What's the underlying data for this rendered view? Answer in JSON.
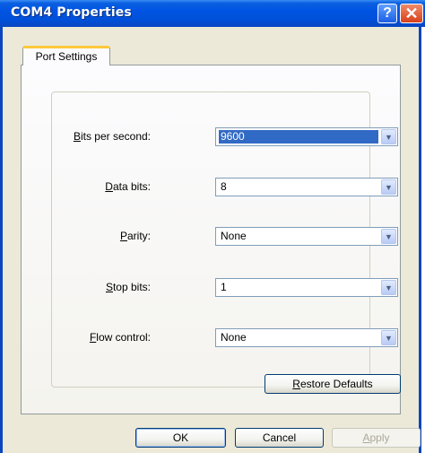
{
  "window": {
    "title": "COM4 Properties",
    "help_glyph": "?",
    "close_glyph": "✕"
  },
  "tabs": [
    {
      "label": "Port Settings",
      "active": true
    }
  ],
  "settings": {
    "bits_per_second": {
      "label_mnemonic": "B",
      "label_rest": "its per second:",
      "value": "9600"
    },
    "data_bits": {
      "label_mnemonic": "D",
      "label_rest": "ata bits:",
      "value": "8"
    },
    "parity": {
      "label_pre": "",
      "label_mnemonic": "P",
      "label_rest": "arity:",
      "value": "None"
    },
    "stop_bits": {
      "label_mnemonic": "S",
      "label_rest": "top bits:",
      "value": "1"
    },
    "flow_control": {
      "label_mnemonic": "F",
      "label_rest": "low control:",
      "value": "None"
    }
  },
  "buttons": {
    "restore_mnemonic": "R",
    "restore_rest": "estore Defaults",
    "ok": "OK",
    "cancel": "Cancel",
    "apply_mnemonic": "A",
    "apply_rest": "pply"
  },
  "icons": {
    "dropdown_arrow": "▼"
  },
  "colors": {
    "titlebar": "#0054e3",
    "tab_highlight": "#ffc83c",
    "selection": "#316ac5"
  }
}
